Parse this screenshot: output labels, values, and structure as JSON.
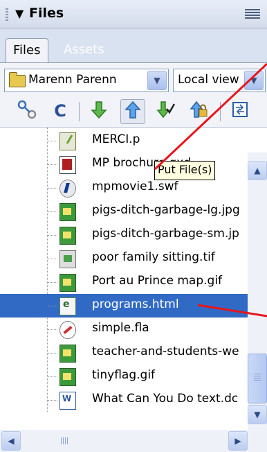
{
  "panel": {
    "title": "Files",
    "collapse_glyph": "▼",
    "menu_icon": "panel-options-icon"
  },
  "tabs": [
    {
      "label": "Files",
      "active": true
    },
    {
      "label": "Assets",
      "active": false
    }
  ],
  "site_select": {
    "value": "Marenn Parenn",
    "icon": "folder-icon"
  },
  "view_select": {
    "value": "Local view"
  },
  "toolbar": {
    "connect_icon": "connect-icon",
    "refresh_icon": "refresh-icon",
    "get_icon": "get-file-icon",
    "put_icon": "put-file-icon",
    "checkout_icon": "check-out-icon",
    "checkin_icon": "check-in-icon",
    "sync_icon": "synchronize-icon"
  },
  "tooltip": "Put File(s)",
  "files": [
    {
      "name": "MERCI.p",
      "icon": "dw"
    },
    {
      "name": "MP brochure.qxd",
      "icon": "qxd"
    },
    {
      "name": "mpmovie1.swf",
      "icon": "swf"
    },
    {
      "name": "pigs-ditch-garbage-lg.jpg",
      "icon": "img"
    },
    {
      "name": "pigs-ditch-garbage-sm.jp",
      "icon": "img"
    },
    {
      "name": "poor family sitting.tif",
      "icon": "tif"
    },
    {
      "name": "Port au Prince map.gif",
      "icon": "img"
    },
    {
      "name": "programs.html",
      "icon": "html",
      "selected": true
    },
    {
      "name": "simple.fla",
      "icon": "fla"
    },
    {
      "name": "teacher-and-students-we",
      "icon": "img"
    },
    {
      "name": "tinyflag.gif",
      "icon": "img"
    },
    {
      "name": "What Can You Do text.dc",
      "icon": "word"
    }
  ],
  "colors": {
    "selection": "#316ac5",
    "annotation": "#e8141c",
    "tab_strip": "#d9e2f0"
  }
}
